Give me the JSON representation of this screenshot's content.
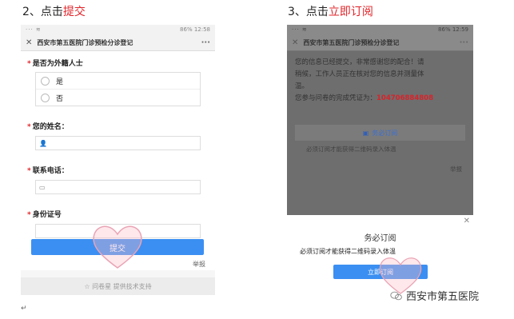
{
  "steps": {
    "left_prefix": "2、点击",
    "left_highlight": "提交",
    "right_prefix": "3、点击",
    "right_highlight": "立即订阅"
  },
  "left_phone": {
    "status_left": "··· ≋",
    "status_right": "86% 12:58",
    "title": "西安市第五医院门诊预检分诊登记",
    "more": "···",
    "questions": {
      "q1": "是否为外籍人士",
      "q1_opt1": "是",
      "q1_opt2": "否",
      "q2": "您的姓名：",
      "q3": "联系电话：",
      "q4": "身份证号"
    },
    "submit": "提交",
    "report": "举报",
    "footer": "☆ 问卷星 提供技术支持"
  },
  "right_phone": {
    "status_left": "··· ≋",
    "status_right": "86% 12:59",
    "title": "西安市第五医院门诊预检分诊登记",
    "more": "···",
    "message_1": "您的信息已经提交，非常感谢您的配合！请",
    "message_2": "稍候，工作人员正在核对您的信息并测量体",
    "message_3": "温。",
    "message_4": "您参与问卷的完成凭证为：",
    "code": "104706884808",
    "subscribe_bar": "务必订阅",
    "note_dim": "必须订阅才能获得二维码录入体温",
    "report_dim": "举报",
    "sheet_title": "务必订阅",
    "sheet_note": "必须订阅才能获得二维码录入体温",
    "sheet_button": "立即订阅",
    "sheet_close": "✕"
  },
  "watermark": "西安市第五医院",
  "return_mark": "↵",
  "colors": {
    "accent_blue": "#3b8ff2",
    "highlight_red": "#e0242a"
  }
}
